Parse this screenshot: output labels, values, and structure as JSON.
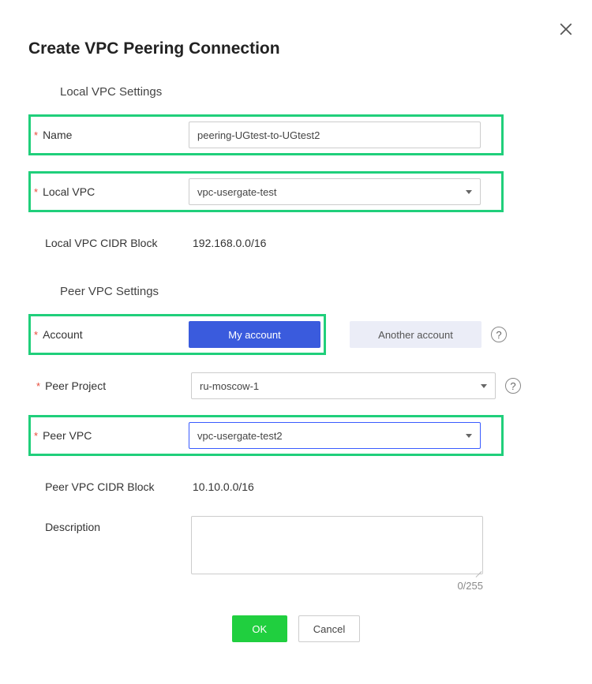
{
  "header": {
    "title": "Create VPC Peering Connection"
  },
  "local": {
    "section": "Local VPC Settings",
    "name_label": "Name",
    "name_value": "peering-UGtest-to-UGtest2",
    "vpc_label": "Local VPC",
    "vpc_value": "vpc-usergate-test",
    "cidr_label": "Local VPC CIDR Block",
    "cidr_value": "192.168.0.0/16"
  },
  "peer": {
    "section": "Peer VPC Settings",
    "account_label": "Account",
    "account_options": {
      "mine": "My account",
      "other": "Another account"
    },
    "account_selected": "mine",
    "project_label": "Peer Project",
    "project_value": "ru-moscow-1",
    "vpc_label": "Peer VPC",
    "vpc_value": "vpc-usergate-test2",
    "cidr_label": "Peer VPC CIDR Block",
    "cidr_value": "10.10.0.0/16",
    "desc_label": "Description",
    "desc_value": "",
    "desc_count": "0/255"
  },
  "footer": {
    "ok": "OK",
    "cancel": "Cancel"
  }
}
